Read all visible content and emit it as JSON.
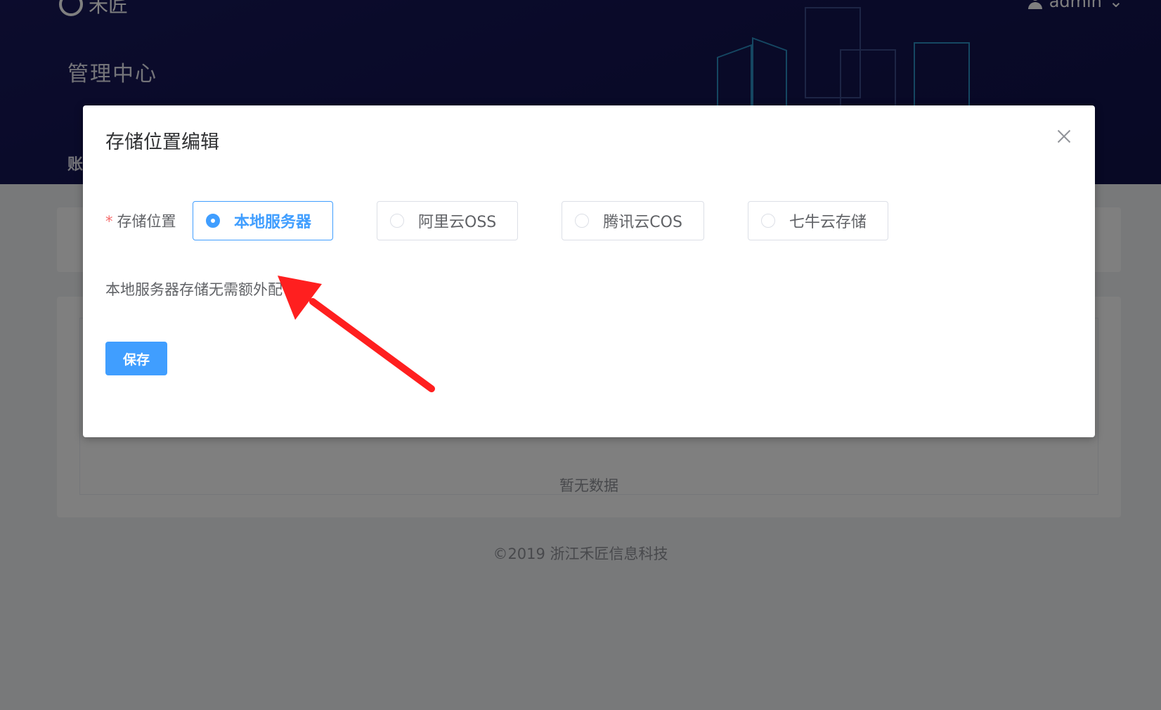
{
  "header": {
    "logo_text": "禾匠",
    "page_title": "管理中心",
    "tab_partial": "账",
    "user_name": "admin",
    "user_chevron": "⌄"
  },
  "table": {
    "empty_text": "暂无数据"
  },
  "footer": {
    "text": "©2019 浙江禾匠信息科技"
  },
  "dialog": {
    "title": "存储位置编辑",
    "form": {
      "required_mark": "*",
      "label": "存储位置",
      "options": [
        {
          "label": "本地服务器",
          "selected": true
        },
        {
          "label": "阿里云OSS",
          "selected": false
        },
        {
          "label": "腾讯云COS",
          "selected": false
        },
        {
          "label": "七牛云存储",
          "selected": false
        }
      ]
    },
    "hint": "本地服务器存储无需额外配",
    "save_label": "保存"
  },
  "colors": {
    "primary": "#409eff",
    "annotation_arrow": "#ff1f1f",
    "header_bg": "#141553"
  }
}
